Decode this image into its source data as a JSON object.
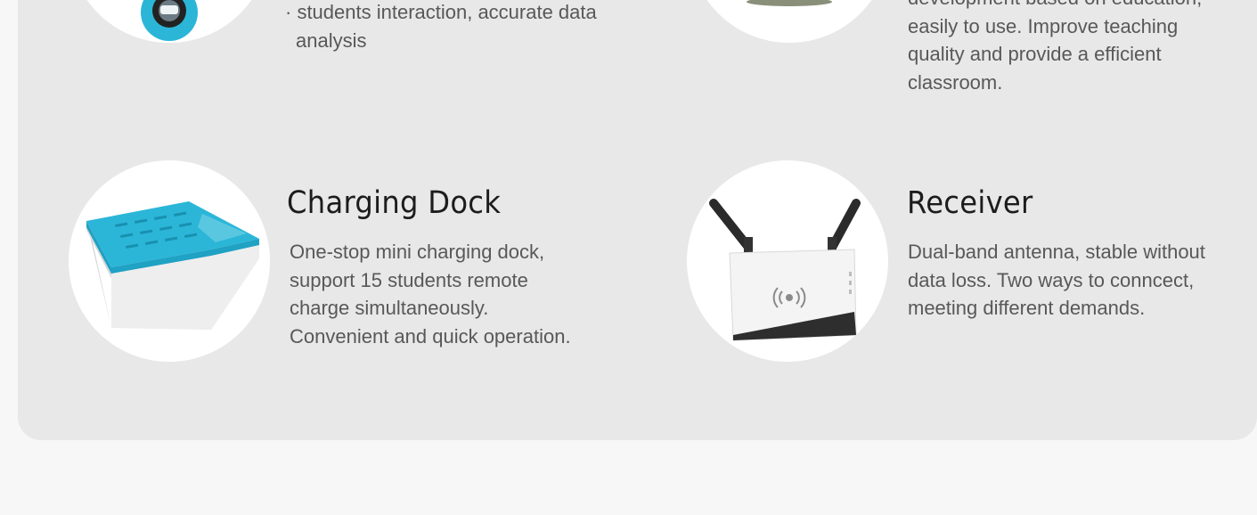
{
  "features": {
    "top_left": {
      "lines": [
        "· students  interaction, accurate data",
        "analysis"
      ]
    },
    "top_right": {
      "lines": [
        "development based on education,",
        "easily to use. Improve teaching",
        "quality and provide a efficient",
        "classroom."
      ]
    },
    "charging_dock": {
      "title": "Charging Dock",
      "lines": [
        "One-stop mini charging dock,",
        "support 15 students remote",
        "charge simultaneously.",
        "Convenient and quick operation."
      ]
    },
    "receiver": {
      "title": "Receiver",
      "lines": [
        "Dual-band antenna, stable without",
        "data loss. Two ways to conncect,",
        "meeting different demands."
      ]
    }
  },
  "colors": {
    "panel_background": "#e8e8e8",
    "page_background": "#f7f7f7",
    "dock_accent": "#2bb6d8"
  },
  "icons": [
    "clicker-device-icon",
    "charging-dock-image",
    "receiver-router-image"
  ]
}
